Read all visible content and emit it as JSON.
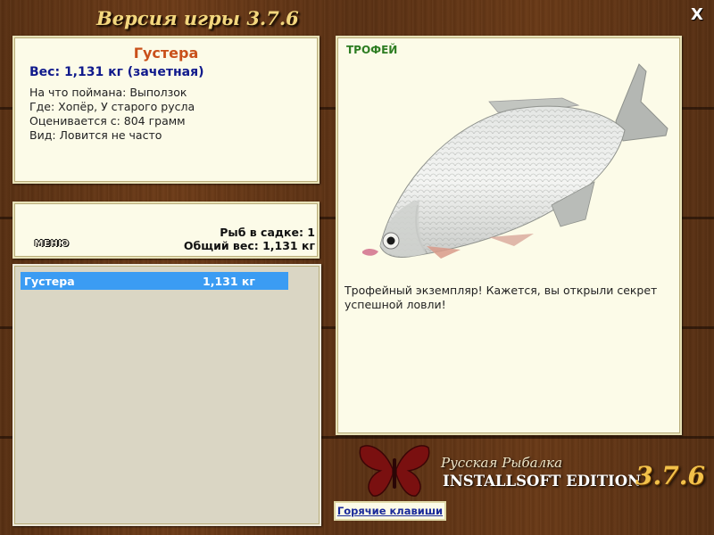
{
  "window": {
    "title": "Версия игры 3.7.6",
    "close_label": "X"
  },
  "fish_info": {
    "name": "Густера",
    "weight": "Вес: 1,131 кг (зачетная)",
    "lines": [
      "На что поймана: Выползок",
      "Где: Хопёр, У старого русла",
      "Оценивается с: 804 грамм",
      "Вид: Ловится не часто"
    ]
  },
  "keepnet": {
    "menu_label": "МЕНЮ",
    "fish_count": "Рыб в садке: 1",
    "total_weight": "Общий вес: 1,131 кг"
  },
  "catch_list": [
    {
      "name": "Густера",
      "weight": "1,131 кг",
      "selected": true
    }
  ],
  "fish_view": {
    "badge": "ТРОФЕЙ",
    "description": "Трофейный экземпляр! Кажется, вы открыли секрет успешной ловли!"
  },
  "branding": {
    "line1": "Русская Рыбалка",
    "line2": "INSTALLSOFT EDITION",
    "version": "3.7.6"
  },
  "hotkeys_label": "Горячие клавиши",
  "colors": {
    "selection": "#3b9cf3",
    "fish_name": "#c9501a",
    "weight_text": "#101a8c",
    "trophy": "#2d7d22",
    "panel_bg": "#fcfbe8",
    "wood": "#6e3c18"
  }
}
